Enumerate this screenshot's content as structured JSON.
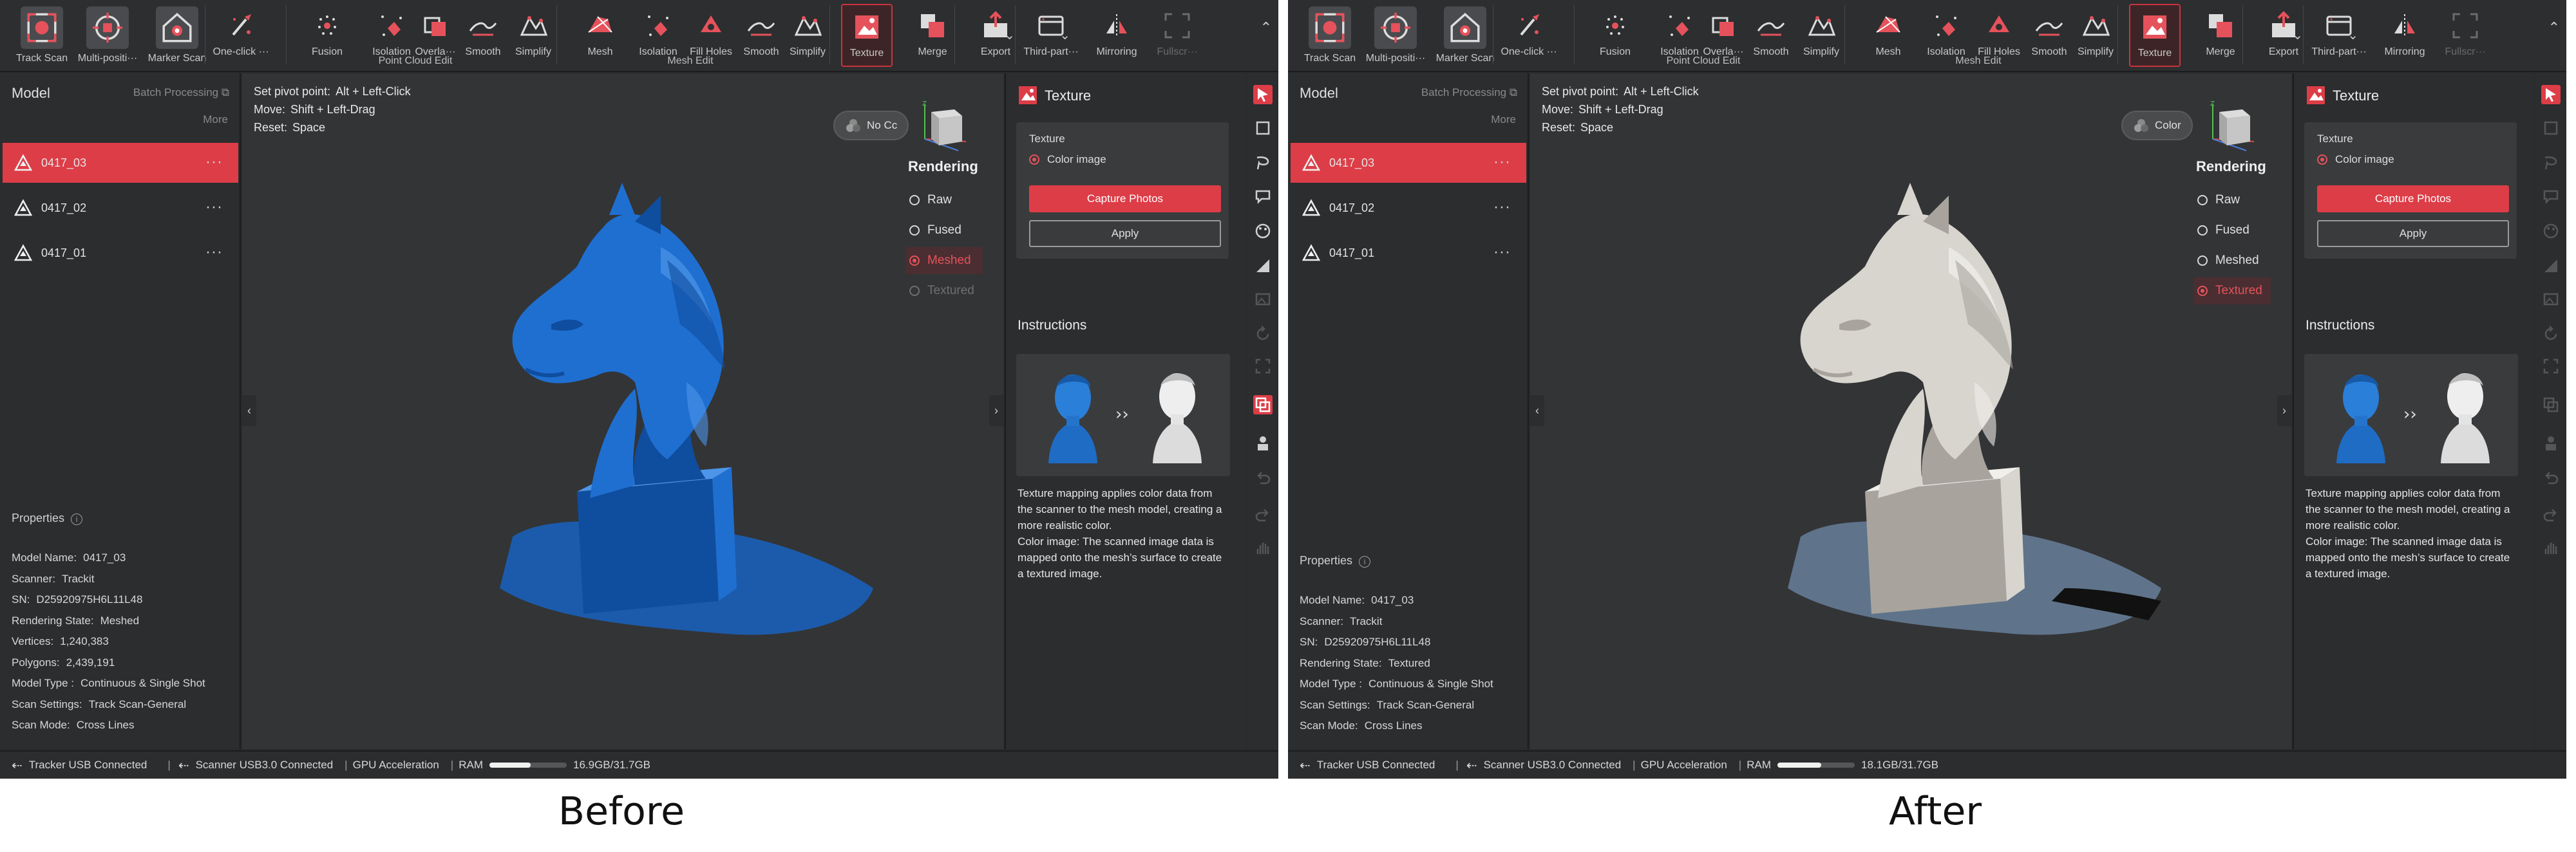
{
  "colors": {
    "accent": "#dd3d47",
    "bg": "#2a2b2d",
    "blue_model": "#1f6fd1",
    "textured_model": "#d8d5cf"
  },
  "captions": {
    "before": "Before",
    "after": "After"
  },
  "toolbar": {
    "tools": [
      {
        "label": "Track Scan",
        "icon": "track-scan-icon"
      },
      {
        "label": "Multi-positi···",
        "icon": "multi-position-icon"
      },
      {
        "label": "Marker Scan",
        "icon": "marker-scan-icon"
      },
      {
        "label": "One-click ···",
        "icon": "one-click-icon"
      },
      {
        "label": "Fusion",
        "icon": "fusion-icon"
      },
      {
        "label": "Isolation",
        "icon": "isolation-icon"
      },
      {
        "label": "Overla···",
        "icon": "overlap-icon"
      },
      {
        "label": "Smooth",
        "icon": "smooth-icon"
      },
      {
        "label": "Simplify",
        "icon": "simplify-icon"
      },
      {
        "label": "Mesh",
        "icon": "mesh-icon"
      },
      {
        "label": "Isolation",
        "icon": "isolation-icon"
      },
      {
        "label": "Fill Holes",
        "icon": "fill-holes-icon"
      },
      {
        "label": "Smooth",
        "icon": "smooth-icon"
      },
      {
        "label": "Simplify",
        "icon": "simplify-icon"
      },
      {
        "label": "Texture",
        "icon": "texture-icon"
      },
      {
        "label": "Merge",
        "icon": "merge-icon"
      },
      {
        "label": "Export",
        "icon": "export-icon"
      },
      {
        "label": "Third-part···",
        "icon": "third-party-icon"
      },
      {
        "label": "Mirroring",
        "icon": "mirroring-icon"
      },
      {
        "label": "Fullscr···",
        "icon": "fullscreen-icon"
      }
    ],
    "groups": {
      "point_cloud": "Point Cloud Edit",
      "mesh": "Mesh Edit"
    }
  },
  "left": {
    "title": "Model",
    "batch": "Batch Processing",
    "more": "More",
    "models": [
      "0417_03",
      "0417_02",
      "0417_01"
    ],
    "properties_title": "Properties"
  },
  "hints": {
    "pivot_k": "Set pivot point:",
    "pivot_v": "Alt + Left-Click",
    "move_k": "Move:",
    "move_v": "Shift + Left-Drag",
    "reset_k": "Reset:",
    "reset_v": "Space"
  },
  "rendering": {
    "title": "Rendering",
    "options": [
      "Raw",
      "Fused",
      "Meshed",
      "Textured"
    ]
  },
  "right": {
    "title": "Texture",
    "texture_label": "Texture",
    "color_image": "Color image",
    "capture": "Capture Photos",
    "apply": "Apply",
    "instructions": "Instructions",
    "desc1": "Texture mapping applies color data from the scanner to the mesh model, creating a more realistic color.",
    "desc2": "Color image: The scanned image data is mapped onto the mesh’s surface to create a textured image."
  },
  "status": {
    "tracker": "Tracker USB Connected",
    "scanner": "Scanner USB3.0 Connected",
    "gpu": "GPU Acceleration",
    "ram_label": "RAM"
  },
  "before": {
    "color_pill": "No Cc",
    "selected_render": "Meshed",
    "ram": "16.9GB/31.7GB",
    "ram_fraction": 0.53,
    "props": [
      [
        "Model Name:",
        "0417_03"
      ],
      [
        "Scanner:",
        "Trackit"
      ],
      [
        "SN:",
        "D25920975H6L11L48"
      ],
      [
        "Rendering State:",
        "Meshed"
      ],
      [
        "Vertices:",
        "1,240,383"
      ],
      [
        "Polygons:",
        "2,439,191"
      ],
      [
        "Model Type :",
        "Continuous & Single Shot"
      ],
      [
        "Scan Settings:",
        "Track Scan-General"
      ],
      [
        "Scan Mode:",
        "Cross Lines"
      ]
    ]
  },
  "after": {
    "color_pill": "Color",
    "selected_render": "Textured",
    "ram": "18.1GB/31.7GB",
    "ram_fraction": 0.57,
    "props": [
      [
        "Model Name:",
        "0417_03"
      ],
      [
        "Scanner:",
        "Trackit"
      ],
      [
        "SN:",
        "D25920975H6L11L48"
      ],
      [
        "Rendering State:",
        "Textured"
      ],
      [
        "Model Type :",
        "Continuous & Single Shot"
      ],
      [
        "Scan Settings:",
        "Track Scan-General"
      ],
      [
        "Scan Mode:",
        "Cross Lines"
      ]
    ]
  }
}
